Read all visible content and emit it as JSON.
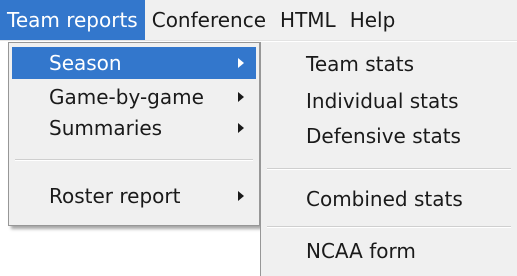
{
  "menubar": {
    "items": [
      {
        "label": "Team reports"
      },
      {
        "label": "Conference"
      },
      {
        "label": "HTML"
      },
      {
        "label": "Help"
      }
    ]
  },
  "team_reports_menu": {
    "items": [
      {
        "label": "Season",
        "has_submenu": true
      },
      {
        "label": "Game-by-game",
        "has_submenu": true
      },
      {
        "label": "Summaries",
        "has_submenu": true
      },
      {
        "label": "Roster report",
        "has_submenu": true
      }
    ]
  },
  "season_submenu": {
    "items": [
      {
        "label": "Team stats"
      },
      {
        "label": "Individual stats"
      },
      {
        "label": "Defensive stats"
      },
      {
        "label": "Combined stats"
      },
      {
        "label": "NCAA form"
      }
    ]
  },
  "colors": {
    "highlight": "#3377cc",
    "menu_background": "#f0f0f0",
    "highlight_text": "#ffffff"
  },
  "icons": {
    "submenu_arrow": "chevron-right-icon"
  }
}
